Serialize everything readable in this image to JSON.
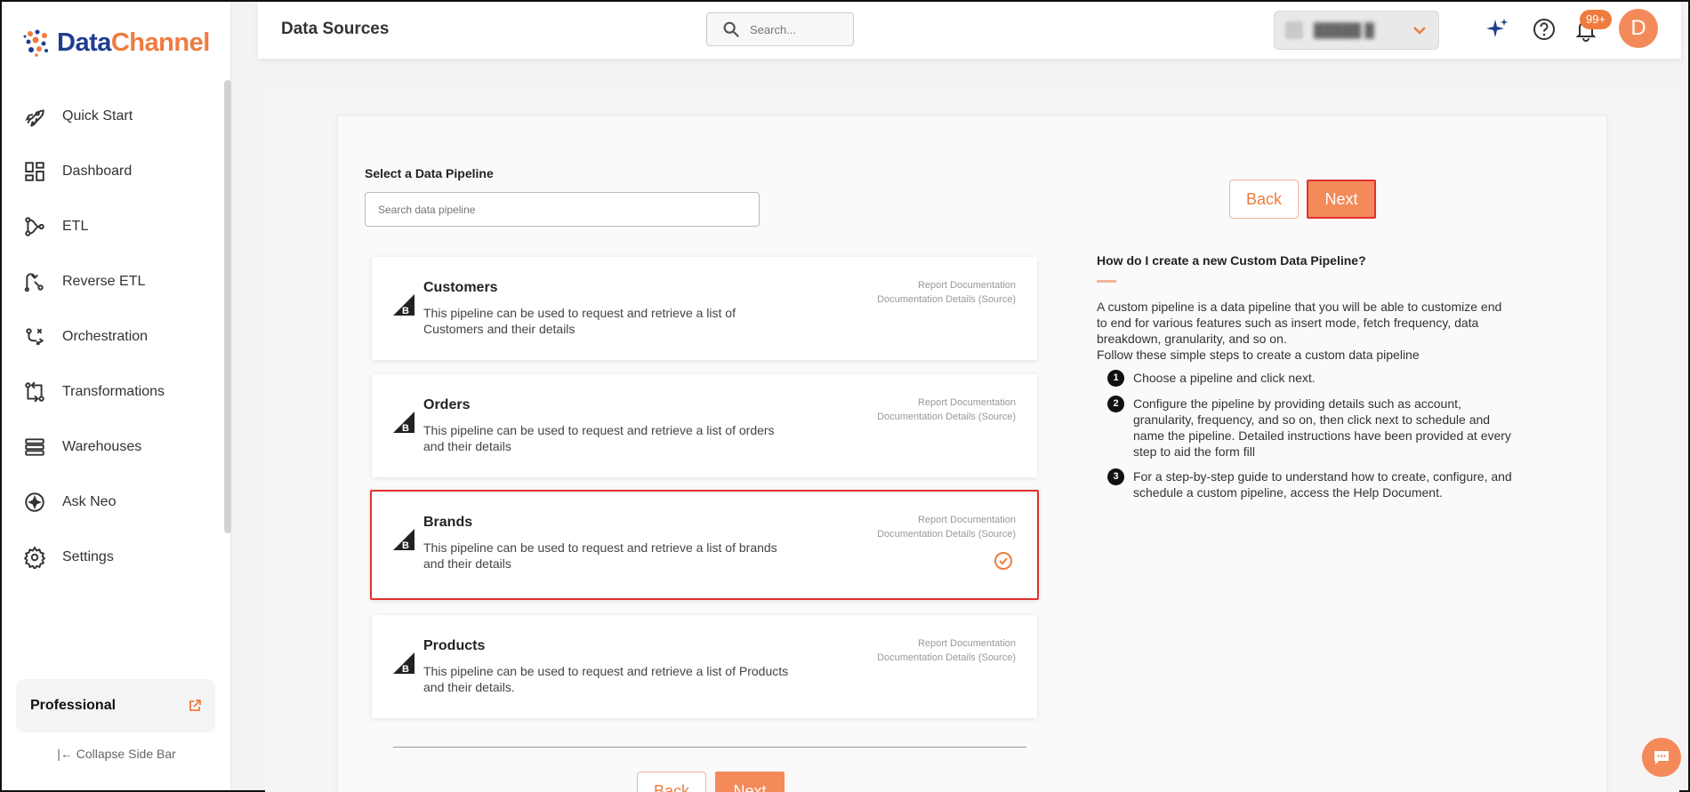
{
  "brand": {
    "part1": "Data",
    "part2": "Channel"
  },
  "header": {
    "title": "Data Sources",
    "search_placeholder": "Search...",
    "notifications_badge": "99+",
    "avatar_initial": "D"
  },
  "sidebar": {
    "items": [
      {
        "label": "Quick Start",
        "icon": "rocket-icon"
      },
      {
        "label": "Dashboard",
        "icon": "dashboard-icon"
      },
      {
        "label": "ETL",
        "icon": "etl-icon"
      },
      {
        "label": "Reverse ETL",
        "icon": "reverse-etl-icon"
      },
      {
        "label": "Orchestration",
        "icon": "orchestration-icon"
      },
      {
        "label": "Transformations",
        "icon": "transformations-icon"
      },
      {
        "label": "Warehouses",
        "icon": "warehouses-icon"
      },
      {
        "label": "Ask Neo",
        "icon": "ask-neo-icon"
      },
      {
        "label": "Settings",
        "icon": "gear-icon"
      }
    ],
    "plan": "Professional",
    "collapse_label": "Collapse Side Bar"
  },
  "main": {
    "select_label": "Select a Data Pipeline",
    "search_placeholder": "Search data pipeline",
    "back_label": "Back",
    "next_label": "Next",
    "doc_link_1": "Report Documentation",
    "doc_link_2": "Documentation Details (Source)",
    "pipelines": [
      {
        "title": "Customers",
        "desc": "This pipeline can be used to request and retrieve a list of Customers and their details",
        "selected": false
      },
      {
        "title": "Orders",
        "desc": "This pipeline can be used to request and retrieve a list of orders and their details",
        "selected": false
      },
      {
        "title": "Brands",
        "desc": "This pipeline can be used to request and retrieve a list of brands and their details",
        "selected": true
      },
      {
        "title": "Products",
        "desc": "This pipeline can be used to request and retrieve a list of Products and their details.",
        "selected": false
      }
    ]
  },
  "help": {
    "title": "How do I create a new Custom Data Pipeline?",
    "intro": "A custom pipeline is a data pipeline that you will be able to customize end to end for various features such as insert mode, fetch frequency, data breakdown, granularity, and so on.",
    "intro2": "Follow these simple steps to create a custom data pipeline",
    "steps": [
      {
        "num": "1",
        "text": "Choose a pipeline and click next."
      },
      {
        "num": "2",
        "text": "Configure the pipeline by providing details such as account, granularity, frequency, and so on, then click next to schedule and name the pipeline. Detailed instructions have been provided at every step to aid the form fill"
      },
      {
        "num": "3",
        "text": "For a step-by-step guide to understand how to create, configure, and schedule a custom pipeline, access the Help Document."
      }
    ]
  },
  "colors": {
    "accent": "#f48a5a",
    "brand_blue": "#1f3d8f",
    "selected_border": "#e0312f"
  }
}
